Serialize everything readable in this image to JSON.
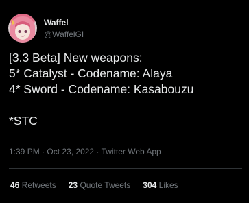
{
  "author": {
    "name": "Waffel",
    "handle": "@WaffelGI"
  },
  "tweet": {
    "lines": [
      "[3.3 Beta] New weapons:",
      "5* Catalyst - Codename: Alaya",
      "4* Sword - Codename: Kasabouzu",
      "",
      "*STC"
    ],
    "time": "1:39 PM",
    "date": "Oct 23, 2022",
    "source": "Twitter Web App",
    "separator": "·"
  },
  "stats": {
    "retweets_count": "46",
    "retweets_label": "Retweets",
    "quotes_count": "23",
    "quotes_label": "Quote Tweets",
    "likes_count": "304",
    "likes_label": "Likes"
  },
  "colors": {
    "background": "#000000",
    "text": "#e7e9ea",
    "muted": "#71767b",
    "divider": "#2f3336"
  }
}
